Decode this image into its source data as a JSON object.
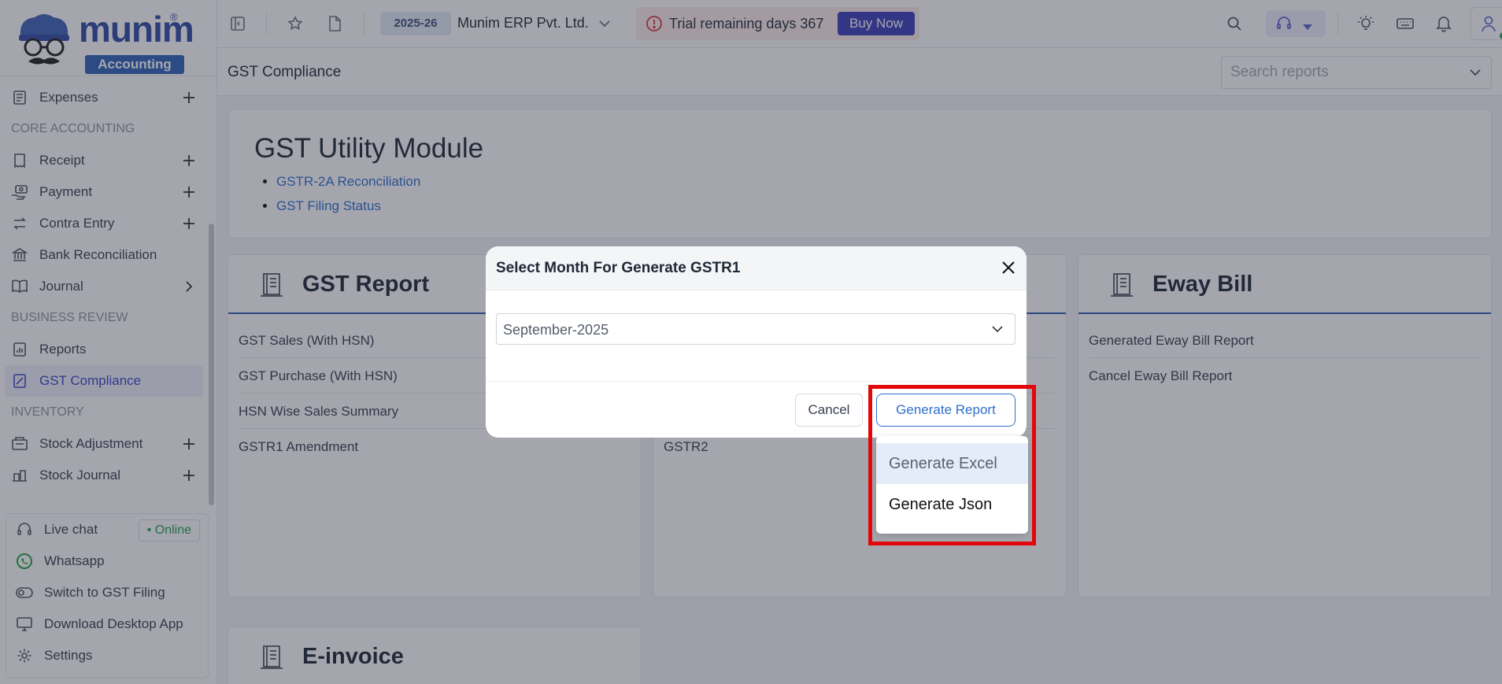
{
  "brand": {
    "name": "munim",
    "registered": "®",
    "tagline": "Accounting"
  },
  "sidebar": {
    "items": [
      {
        "type": "item",
        "label": "Expenses",
        "icon": "expenses-icon",
        "action": "plus"
      },
      {
        "type": "section",
        "label": "CORE ACCOUNTING"
      },
      {
        "type": "item",
        "label": "Receipt",
        "icon": "receipt-icon",
        "action": "plus"
      },
      {
        "type": "item",
        "label": "Payment",
        "icon": "payment-icon",
        "action": "plus"
      },
      {
        "type": "item",
        "label": "Contra Entry",
        "icon": "contra-icon",
        "action": "plus"
      },
      {
        "type": "item",
        "label": "Bank Reconciliation",
        "icon": "bank-icon"
      },
      {
        "type": "item",
        "label": "Journal",
        "icon": "book-icon",
        "action": "chevron"
      },
      {
        "type": "section",
        "label": "BUSINESS REVIEW"
      },
      {
        "type": "item",
        "label": "Reports",
        "icon": "report-icon"
      },
      {
        "type": "item",
        "label": "GST Compliance",
        "icon": "gst-icon",
        "active": true
      },
      {
        "type": "section",
        "label": "INVENTORY"
      },
      {
        "type": "item",
        "label": "Stock Adjustment",
        "icon": "stock-adjust-icon",
        "action": "plus"
      },
      {
        "type": "item",
        "label": "Stock Journal",
        "icon": "stock-journal-icon",
        "action": "plus"
      }
    ],
    "bottom": {
      "live_chat": "Live chat",
      "online": "• Online",
      "whatsapp": "Whatsapp",
      "switch_gst": "Switch to GST Filing",
      "download": "Download Desktop App",
      "settings": "Settings"
    }
  },
  "topbar": {
    "year": "2025-26",
    "company": "Munim ERP Pvt. Ltd.",
    "trial_text": "Trial remaining days 367",
    "buy_now": "Buy Now"
  },
  "page": {
    "title": "GST Compliance",
    "search_placeholder": "Search reports"
  },
  "utility": {
    "title": "GST Utility Module",
    "links": [
      "GSTR-2A Reconciliation",
      "GST Filing Status"
    ]
  },
  "gst_report": {
    "title": "GST Report",
    "links": [
      "GST Sales (With HSN)",
      "GST Purchase (With HSN)",
      "HSN Wise Sales Summary",
      "GSTR1 Amendment"
    ]
  },
  "middle_card": {
    "visible_link": "GSTR2"
  },
  "eway_bill": {
    "title": "Eway Bill",
    "links": [
      "Generated Eway Bill Report",
      "Cancel Eway Bill Report"
    ]
  },
  "einvoice": {
    "title": "E-invoice"
  },
  "modal": {
    "title": "Select Month For Generate GSTR1",
    "month_value": "September-2025",
    "cancel": "Cancel",
    "generate": "Generate Report",
    "options": [
      "Generate Excel",
      "Generate Json"
    ]
  },
  "colors": {
    "accent": "#2f6fce",
    "brand": "#2f4aa5",
    "highlight_box": "#e3070b",
    "online_green": "#1f9d55"
  }
}
